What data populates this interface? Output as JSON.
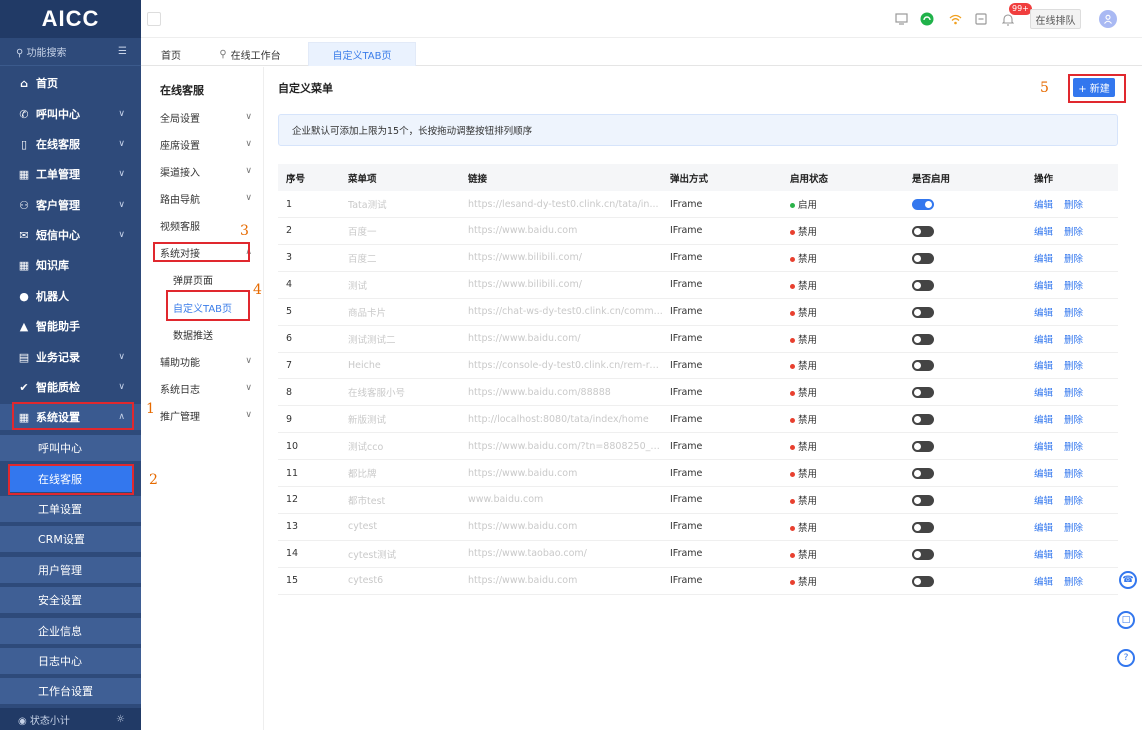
{
  "app": {
    "logo": "AICC"
  },
  "sidebar": {
    "search_label": "功能搜索",
    "items": [
      {
        "label": "首页",
        "icon": "home-icon",
        "chev": ""
      },
      {
        "label": "呼叫中心",
        "icon": "phone-icon",
        "chev": "∨"
      },
      {
        "label": "在线客服",
        "icon": "chat-icon",
        "chev": "∨"
      },
      {
        "label": "工单管理",
        "icon": "ticket-icon",
        "chev": "∨"
      },
      {
        "label": "客户管理",
        "icon": "users-icon",
        "chev": "∨"
      },
      {
        "label": "短信中心",
        "icon": "mail-icon",
        "chev": "∨"
      },
      {
        "label": "知识库",
        "icon": "grid-icon",
        "chev": ""
      },
      {
        "label": "机器人",
        "icon": "robot-icon",
        "chev": ""
      },
      {
        "label": "智能助手",
        "icon": "assistant-icon",
        "chev": ""
      },
      {
        "label": "业务记录",
        "icon": "record-icon",
        "chev": "∨"
      },
      {
        "label": "智能质检",
        "icon": "check-icon",
        "chev": "∨"
      },
      {
        "label": "系统设置",
        "icon": "settings-icon",
        "chev": "∧"
      }
    ],
    "sub_items": [
      {
        "label": "呼叫中心"
      },
      {
        "label": "在线客服"
      },
      {
        "label": "工单设置"
      },
      {
        "label": "CRM设置"
      },
      {
        "label": "用户管理"
      },
      {
        "label": "安全设置"
      },
      {
        "label": "企业信息"
      },
      {
        "label": "日志中心"
      },
      {
        "label": "工作台设置"
      }
    ],
    "footer_label": "状态小计"
  },
  "header": {
    "badge": "99+",
    "queue_label": "在线排队"
  },
  "tabs": [
    {
      "label": "首页"
    },
    {
      "label": "在线工作台"
    },
    {
      "label": "自定义TAB页"
    }
  ],
  "submenu": {
    "title": "在线客服",
    "items": [
      {
        "label": "全局设置",
        "chev": "∨"
      },
      {
        "label": "座席设置",
        "chev": "∨"
      },
      {
        "label": "渠道接入",
        "chev": "∨"
      },
      {
        "label": "路由导航",
        "chev": "∨"
      },
      {
        "label": "视频客服",
        "chev": ""
      },
      {
        "label": "系统对接",
        "chev": "∧"
      }
    ],
    "sub_items": [
      {
        "label": "弹屏页面"
      },
      {
        "label": "自定义TAB页"
      },
      {
        "label": "数据推送"
      }
    ],
    "items_after": [
      {
        "label": "辅助功能",
        "chev": "∨"
      },
      {
        "label": "系统日志",
        "chev": "∨"
      },
      {
        "label": "推广管理",
        "chev": "∨"
      }
    ]
  },
  "main": {
    "title": "自定义菜单",
    "new_button": "+ 新建",
    "notice": "企业默认可添加上限为15个，长按拖动调整按钮排列顺序",
    "columns": [
      "序号",
      "菜单项",
      "链接",
      "弹出方式",
      "启用状态",
      "是否启用",
      "操作"
    ],
    "edit_label": "编辑",
    "delete_label": "删除",
    "rows": [
      {
        "no": "1",
        "name": "Tata测试",
        "link": "https://lesand-dy-test0.clink.cn/tata/in...",
        "mode": "IFrame",
        "status": "启用",
        "on": true
      },
      {
        "no": "2",
        "name": "百度一",
        "link": "https://www.baidu.com",
        "mode": "IFrame",
        "status": "禁用",
        "on": false
      },
      {
        "no": "3",
        "name": "百度二",
        "link": "https://www.bilibili.com/",
        "mode": "IFrame",
        "status": "禁用",
        "on": false
      },
      {
        "no": "4",
        "name": "测试",
        "link": "https://www.bilibili.com/",
        "mode": "IFrame",
        "status": "禁用",
        "on": false
      },
      {
        "no": "5",
        "name": "商品卡片",
        "link": "https://chat-ws-dy-test0.clink.cn/comm...",
        "mode": "IFrame",
        "status": "禁用",
        "on": false
      },
      {
        "no": "6",
        "name": "测试测试二",
        "link": "https://www.baidu.com/",
        "mode": "IFrame",
        "status": "禁用",
        "on": false
      },
      {
        "no": "7",
        "name": "Heiche",
        "link": "https://console-dy-test0.clink.cn/rem-re...",
        "mode": "IFrame",
        "status": "禁用",
        "on": false
      },
      {
        "no": "8",
        "name": "在线客服小号",
        "link": "https://www.baidu.com/88888",
        "mode": "IFrame",
        "status": "禁用",
        "on": false
      },
      {
        "no": "9",
        "name": "新版测试",
        "link": "http://localhost:8080/tata/index/home",
        "mode": "IFrame",
        "status": "禁用",
        "on": false
      },
      {
        "no": "10",
        "name": "测试cco",
        "link": "https://www.baidu.com/?tn=8808250_1...",
        "mode": "IFrame",
        "status": "禁用",
        "on": false
      },
      {
        "no": "11",
        "name": "都比牌",
        "link": "https://www.baidu.com",
        "mode": "IFrame",
        "status": "禁用",
        "on": false
      },
      {
        "no": "12",
        "name": "都市test",
        "link": "www.baidu.com",
        "mode": "IFrame",
        "status": "禁用",
        "on": false
      },
      {
        "no": "13",
        "name": "cytest",
        "link": "https://www.baidu.com",
        "mode": "IFrame",
        "status": "禁用",
        "on": false
      },
      {
        "no": "14",
        "name": "cytest测试",
        "link": "https://www.taobao.com/",
        "mode": "IFrame",
        "status": "禁用",
        "on": false
      },
      {
        "no": "15",
        "name": "cytest6",
        "link": "https://www.baidu.com",
        "mode": "IFrame",
        "status": "禁用",
        "on": false
      }
    ]
  },
  "annotations": [
    "1",
    "2",
    "3",
    "4",
    "5"
  ],
  "colors": {
    "sidebar": "#2e4a7a",
    "accent": "#3377ee",
    "enabled": "#2bb34a",
    "disabled": "#e8402f",
    "annotation": "#e66a00",
    "highlight_box": "#e0282e"
  }
}
